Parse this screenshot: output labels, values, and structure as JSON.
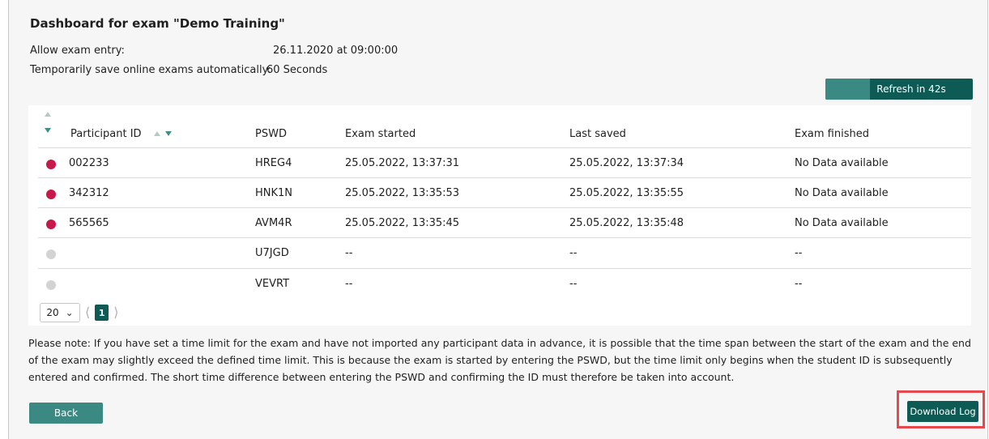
{
  "header": {
    "title": "Dashboard for exam \"Demo Training\"",
    "entry_label": "Allow exam entry:",
    "entry_value": "26.11.2020 at 09:00:00",
    "autosave_label": "Temporarily save online exams automatically:",
    "autosave_value": "60 Seconds"
  },
  "refresh": {
    "label": "Refresh in 42s",
    "progress_fraction": 0.3
  },
  "table": {
    "columns": [
      "Participant ID",
      "PSWD",
      "Exam started",
      "Last saved",
      "Exam finished"
    ],
    "rows": [
      {
        "status": "active",
        "id": "002233",
        "pswd": "HREG4",
        "started": "25.05.2022, 13:37:31",
        "saved": "25.05.2022, 13:37:34",
        "finished": "No Data available"
      },
      {
        "status": "active",
        "id": "342312",
        "pswd": "HNK1N",
        "started": "25.05.2022, 13:35:53",
        "saved": "25.05.2022, 13:35:55",
        "finished": "No Data available"
      },
      {
        "status": "active",
        "id": "565565",
        "pswd": "AVM4R",
        "started": "25.05.2022, 13:35:45",
        "saved": "25.05.2022, 13:35:48",
        "finished": "No Data available"
      },
      {
        "status": "inactive",
        "id": "",
        "pswd": "U7JGD",
        "started": "--",
        "saved": "--",
        "finished": "--"
      },
      {
        "status": "inactive",
        "id": "",
        "pswd": "VEVRT",
        "started": "--",
        "saved": "--",
        "finished": "--"
      }
    ]
  },
  "pager": {
    "page_size": "20",
    "current_page": "1"
  },
  "note": "Please note: If you have set a time limit for the exam and have not imported any participant data in advance, it is possible that the time span between the start of the exam and the end of the exam may slightly exceed the defined time limit. This is because the exam is started by entering the PSWD, but the time limit only begins when the student ID is subsequently entered and confirmed. The short time difference between entering the PSWD and confirming the ID must therefore be taken into account.",
  "actions": {
    "back": "Back",
    "download": "Download Log"
  },
  "colors": {
    "accent": "#0e5b56",
    "accent_light": "#3a8a83",
    "active_dot": "#c8174a",
    "inactive_dot": "#d3d3d3",
    "highlight": "#e5484d"
  }
}
